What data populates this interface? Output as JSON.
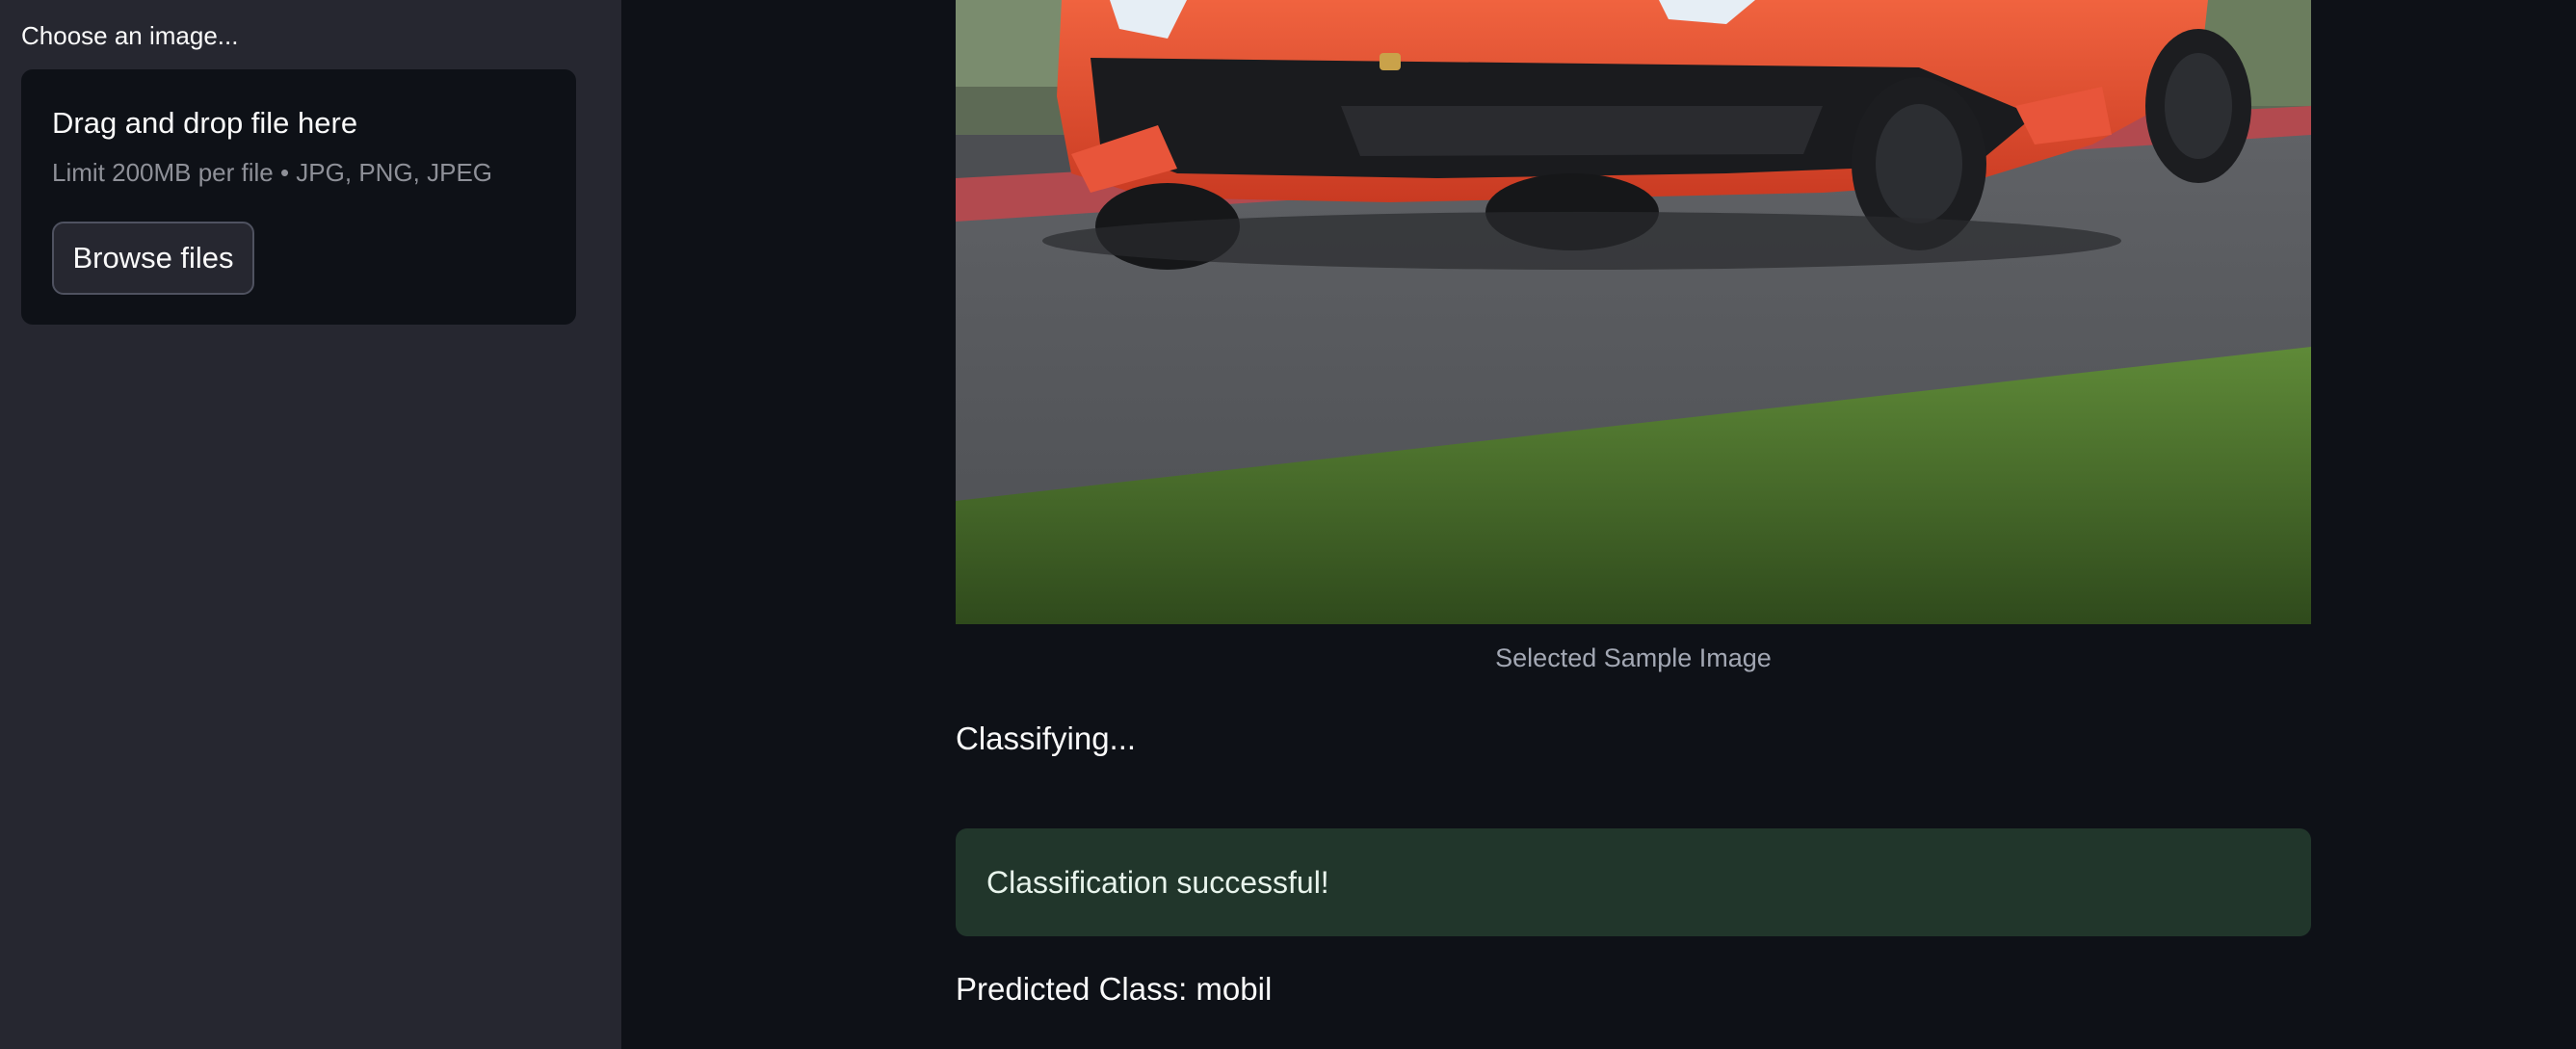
{
  "sidebar": {
    "uploader_label": "Choose an image...",
    "dropzone": {
      "title": "Drag and drop file here",
      "limit": "Limit 200MB per file • JPG, PNG, JPEG",
      "browse_label": "Browse files"
    }
  },
  "main": {
    "image": {
      "subject": "orange sports car on race track"
    },
    "caption": "Selected Sample Image",
    "status": "Classifying...",
    "alert": {
      "text": "Classification successful!",
      "color": "#21362b"
    },
    "prediction": "Predicted Class: mobil"
  },
  "colors": {
    "background": "#0e1117",
    "sidebar": "#262730",
    "text": "#fafafa",
    "muted": "#8e9098"
  }
}
